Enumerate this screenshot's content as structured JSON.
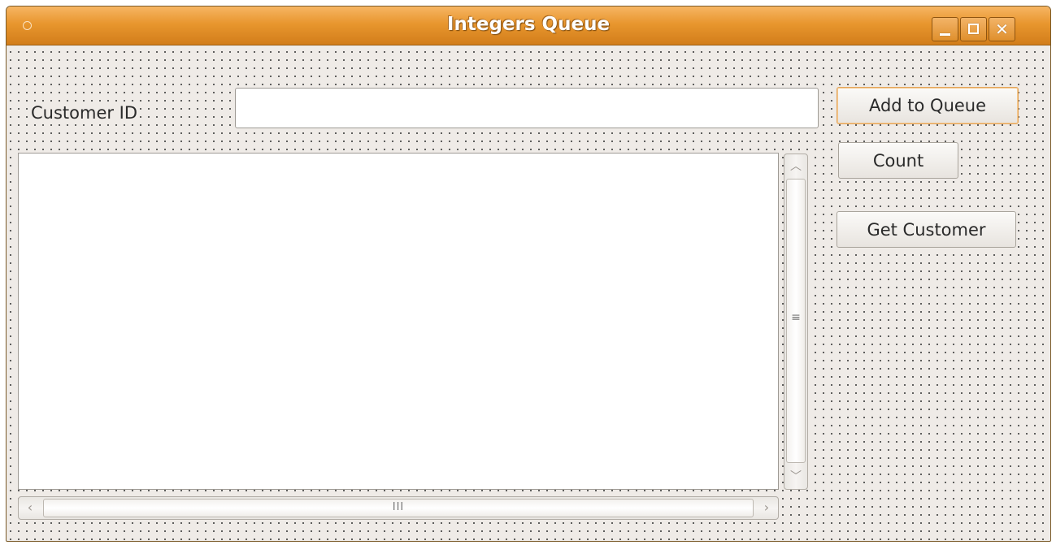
{
  "window": {
    "title": "Integers Queue",
    "controls": {
      "minimize_icon": "minimize-icon",
      "maximize_icon": "maximize-icon",
      "close_icon": "close-icon",
      "close_glyph": "✕"
    }
  },
  "form": {
    "customer_id_label": "Customer ID",
    "customer_id_value": "",
    "add_button_label": "Add to Queue",
    "count_button_label": "Count",
    "get_customer_button_label": "Get Customer"
  },
  "listbox": {
    "items": []
  },
  "scrollbars": {
    "up_arrow": "︿",
    "down_arrow": "﹀",
    "left_arrow": "‹",
    "right_arrow": "›",
    "v_grip": "≡",
    "h_grip": "III"
  },
  "colors": {
    "titlebar_accent": "#e8962e",
    "window_background": "#efebe7",
    "focused_button_border": "#e3a45a"
  }
}
